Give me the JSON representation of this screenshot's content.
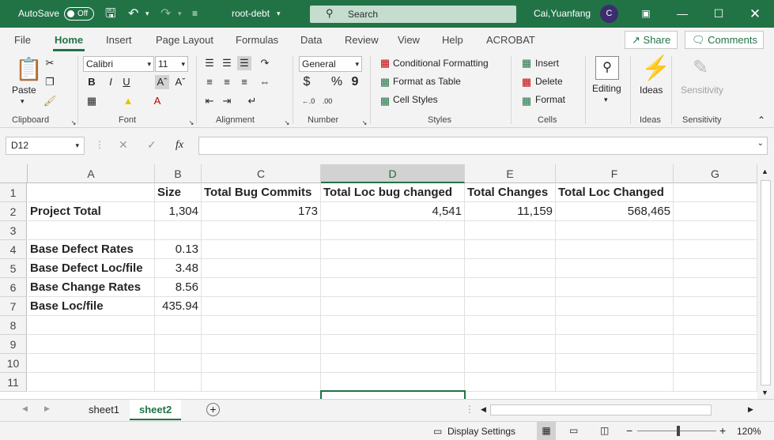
{
  "titlebar": {
    "autosave_label": "AutoSave",
    "autosave_state": "Off",
    "filename": "root-debt",
    "search_label": "Search",
    "user_name": "Cai,Yuanfang",
    "user_initial": "C"
  },
  "tabs": [
    "File",
    "Home",
    "Insert",
    "Page Layout",
    "Formulas",
    "Data",
    "Review",
    "View",
    "Help",
    "ACROBAT"
  ],
  "active_tab": "Home",
  "share_label": "Share",
  "comments_label": "Comments",
  "ribbon": {
    "clipboard": {
      "paste": "Paste",
      "label": "Clipboard"
    },
    "font": {
      "name": "Calibri",
      "size": "11",
      "bold": "B",
      "italic": "I",
      "underline": "U",
      "label": "Font"
    },
    "alignment": {
      "label": "Alignment"
    },
    "number": {
      "format": "General",
      "currency": "$",
      "percent": "%",
      "comma": "9",
      "label": "Number"
    },
    "styles": {
      "conditional": "Conditional Formatting",
      "table": "Format as Table",
      "cell_styles": "Cell Styles",
      "label": "Styles"
    },
    "cells": {
      "insert": "Insert",
      "delete": "Delete",
      "format": "Format",
      "label": "Cells"
    },
    "editing": {
      "label": "Editing"
    },
    "ideas": {
      "button": "Ideas",
      "label": "Ideas"
    },
    "sensitivity": {
      "button": "Sensitivity",
      "label": "Sensitivity"
    }
  },
  "formula_bar": {
    "name_box": "D12",
    "fx": "fx",
    "content": ""
  },
  "columns": [
    "A",
    "B",
    "C",
    "D",
    "E",
    "F",
    "G"
  ],
  "selected_column": "D",
  "rows": [
    "1",
    "2",
    "3",
    "4",
    "5",
    "6",
    "7",
    "8",
    "9",
    "10",
    "11"
  ],
  "cells": {
    "B1": "Size",
    "C1": "Total Bug Commits",
    "D1": "Total Loc bug changed",
    "E1": "Total Changes",
    "F1": "Total Loc Changed",
    "A2": "Project Total",
    "B2": "1,304",
    "C2": "173",
    "D2": "4,541",
    "E2": "11,159",
    "F2": "568,465",
    "A4": "Base Defect Rates",
    "B4": "0.13",
    "A5": "Base Defect Loc/file",
    "B5": "3.48",
    "A6": "Base Change Rates",
    "B6": "8.56",
    "A7": "Base Loc/file",
    "B7": "435.94"
  },
  "sheets": [
    "sheet1",
    "sheet2"
  ],
  "active_sheet": "sheet2",
  "status": {
    "display_settings": "Display Settings",
    "zoom": "120%"
  }
}
